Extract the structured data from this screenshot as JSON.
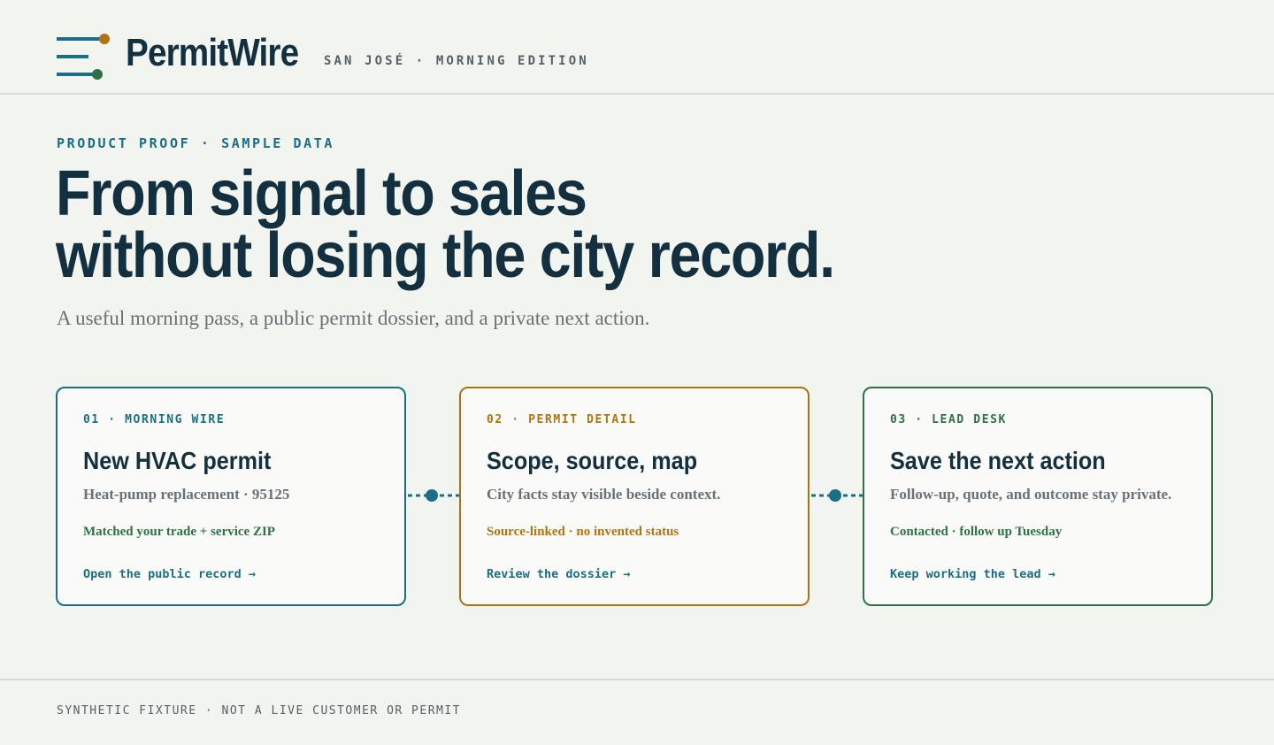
{
  "header": {
    "brand": "PermitWire",
    "edition": "SAN JOSÉ · MORNING EDITION",
    "logo_icon": "wire-lines-logo"
  },
  "hero": {
    "eyebrow": "PRODUCT PROOF · SAMPLE DATA",
    "headline_line1": "From signal to sales",
    "headline_line2": "without losing the city record.",
    "subhead": "A useful morning pass, a public permit dossier, and a private next action."
  },
  "cards": [
    {
      "kicker": "01 · MORNING WIRE",
      "title": "New HVAC permit",
      "desc": "Heat-pump replacement · 95125",
      "note": "Matched your trade + service ZIP",
      "link": "Open the public record →"
    },
    {
      "kicker": "02 · PERMIT DETAIL",
      "title": "Scope, source, map",
      "desc": "City facts stay visible beside context.",
      "note": "Source-linked · no invented status",
      "link": "Review the dossier →"
    },
    {
      "kicker": "03 · LEAD DESK",
      "title": "Save the next action",
      "desc": "Follow-up, quote, and outcome stay private.",
      "note": "Contacted · follow up Tuesday",
      "link": "Keep working the lead →"
    }
  ],
  "footer": {
    "text": "SYNTHETIC FIXTURE · NOT A LIVE CUSTOMER OR PERMIT"
  },
  "colors": {
    "background": "#f2f4ef",
    "ink": "#12303f",
    "teal": "#1a6f85",
    "amber": "#b0740f",
    "green": "#2f7047"
  }
}
